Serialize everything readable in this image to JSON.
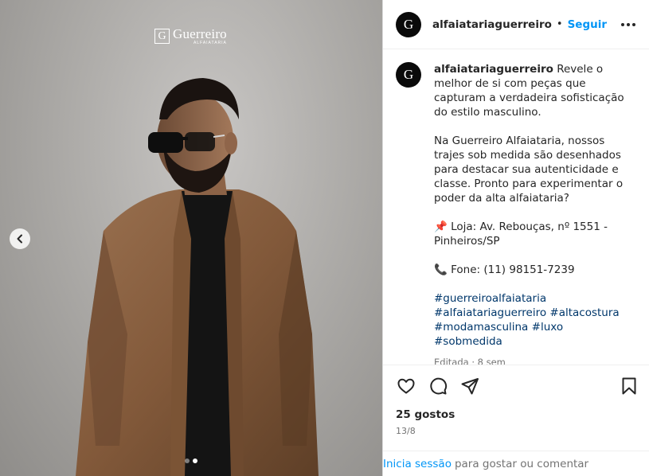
{
  "post": {
    "username": "alfaiatariaguerreiro",
    "follow_label": "Seguir",
    "separator": "•"
  },
  "media": {
    "brand_mark": "G",
    "brand_name": "Guerreiro",
    "brand_sub": "ALFAIATARIA",
    "slide_count": 2,
    "active_slide": 2
  },
  "avatar_glyph": "G",
  "caption": {
    "username": "alfaiatariaguerreiro",
    "p1": "Revele o melhor de si com peças que capturam a verdadeira sofisticação do estilo masculino.",
    "p2": "Na Guerreiro Alfaiataria, nossos trajes sob medida são desenhados para destacar sua autenticidade e classe. Pronto para experimentar o poder da alta alfaiataria?",
    "store_icon": "📌",
    "store": "Loja: Av. Rebouças, nº 1551 - Pinheiros/SP",
    "phone_icon": "📞",
    "phone": "Fone: (11) 98151-7239",
    "hashtags": [
      "#guerreiroalfaiataria",
      "#alfaiatariaguerreiro",
      "#altacostura",
      "#modamasculina",
      "#luxo",
      "#sobmedida"
    ],
    "meta": "Editada · 8 sem"
  },
  "stats": {
    "likes": "25 gostos",
    "date": "13/8"
  },
  "login": {
    "link": "Inicia sessão",
    "text": "para gostar ou comentar"
  },
  "icons": {
    "like": "heart-icon",
    "comment": "comment-icon",
    "share": "share-icon",
    "save": "bookmark-icon",
    "more": "more-icon",
    "prev": "chevron-left-icon"
  },
  "colors": {
    "link_blue": "#0095f6",
    "hashtag": "#00376b",
    "jacket": "#8a6240"
  }
}
